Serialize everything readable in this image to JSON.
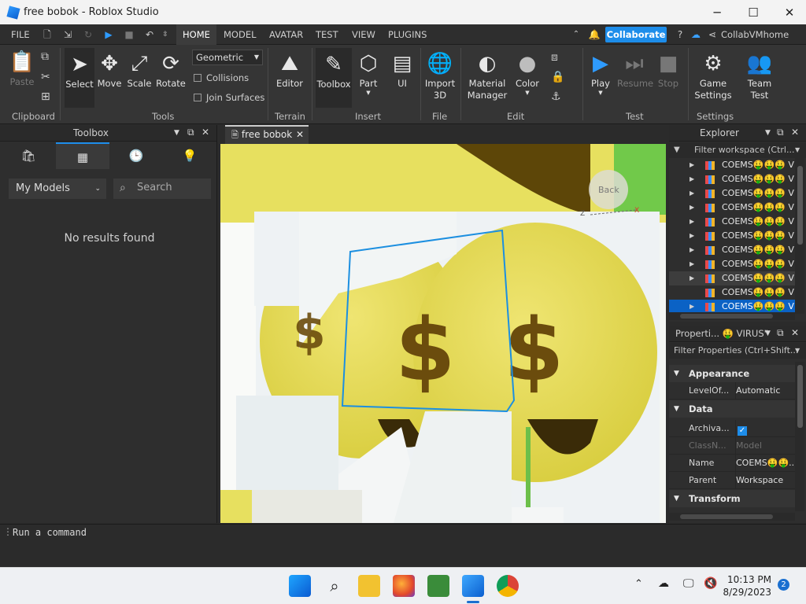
{
  "window": {
    "title": "free bobok - Roblox Studio",
    "minimize_glyph": "─",
    "maximize_glyph": "☐",
    "close_glyph": "✕"
  },
  "menu": {
    "file": "FILE",
    "tabs": [
      "HOME",
      "MODEL",
      "AVATAR",
      "TEST",
      "VIEW",
      "PLUGINS"
    ],
    "active_tab": "HOME",
    "collaborate_label": "Collaborate",
    "username": "CollabVMhome"
  },
  "ribbon": {
    "clipboard": {
      "paste": "Paste",
      "group": "Clipboard"
    },
    "tools": {
      "select": "Select",
      "move": "Move",
      "scale": "Scale",
      "rotate": "Rotate",
      "mode_value": "Geometric",
      "collisions": "Collisions",
      "join_surfaces": "Join Surfaces",
      "group": "Tools"
    },
    "terrain": {
      "editor": "Editor",
      "group": "Terrain"
    },
    "insert": {
      "toolbox": "Toolbox",
      "part": "Part",
      "ui": "UI",
      "group": "Insert"
    },
    "file": {
      "import_line1": "Import",
      "import_line2": "3D",
      "group": "File"
    },
    "edit": {
      "material_line1": "Material",
      "material_line2": "Manager",
      "color": "Color",
      "group": "Edit"
    },
    "test": {
      "play": "Play",
      "resume": "Resume",
      "stop": "Stop",
      "group": "Test"
    },
    "settings": {
      "game_line1": "Game",
      "game_line2": "Settings",
      "team_line1": "Team",
      "team_line2": "Test",
      "group": "Settings"
    }
  },
  "toolbox": {
    "title": "Toolbox",
    "category_value": "My Models",
    "search_placeholder": "Search",
    "empty_message": "No results found"
  },
  "viewport": {
    "doc_tab": "free bobok",
    "back_label": "Back",
    "axis_z": "Z",
    "axis_x": "X"
  },
  "explorer": {
    "title": "Explorer",
    "filter_placeholder": "Filter workspace (Ctrl...",
    "items": [
      {
        "label": "COEMS🤑🤑🤑 V",
        "arrow": true
      },
      {
        "label": "COEMS🤑🤑🤑 V",
        "arrow": true
      },
      {
        "label": "COEMS🤑🤑🤑 V",
        "arrow": true
      },
      {
        "label": "COEMS🤑🤑🤑 V",
        "arrow": true
      },
      {
        "label": "COEMS🤑🤑🤑 V",
        "arrow": true
      },
      {
        "label": "COEMS🤑🤑🤑 V",
        "arrow": true
      },
      {
        "label": "COEMS🤑🤑🤑 V",
        "arrow": true
      },
      {
        "label": "COEMS🤑🤑🤑 V",
        "arrow": true
      },
      {
        "label": "COEMS🤑🤑🤑 V",
        "arrow": true
      },
      {
        "label": "COEMS🤑🤑🤑 V",
        "arrow": false
      },
      {
        "label": "COEMS🤑🤑🤑 V",
        "arrow": true
      }
    ]
  },
  "properties": {
    "title": "Properti... 🤑 VIRUS\"",
    "filter_placeholder": "Filter Properties (Ctrl+Shift...",
    "categories": {
      "appearance": "Appearance",
      "data": "Data",
      "transform": "Transform"
    },
    "rows": {
      "level_of_detail": {
        "key": "LevelOf...",
        "value": "Automatic"
      },
      "archivable": {
        "key": "Archiva...",
        "value": "✓"
      },
      "classname": {
        "key": "ClassN...",
        "value": "Model"
      },
      "name": {
        "key": "Name",
        "value": "COEMS🤑🤑..."
      },
      "parent": {
        "key": "Parent",
        "value": "Workspace"
      }
    }
  },
  "command_bar": {
    "placeholder": "Run a command"
  },
  "taskbar": {
    "time": "10:13 PM",
    "date": "8/29/2023",
    "notification_count": "2"
  },
  "colors": {
    "accent": "#1d8dea",
    "selection": "#0b62c5",
    "emoji_yellow": "#e9df57",
    "dollar_brown": "#6b4c0d"
  }
}
